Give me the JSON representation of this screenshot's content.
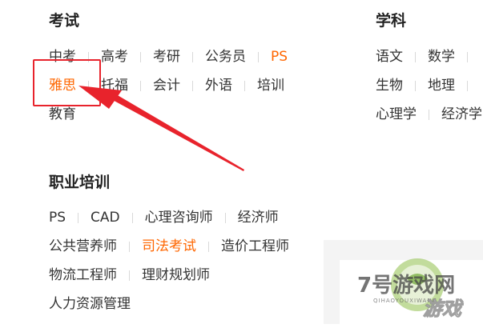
{
  "exam": {
    "title": "考试",
    "row1": [
      "中考",
      "高考",
      "考研",
      "公务员",
      "PS"
    ],
    "row2": [
      "雅思",
      "托福",
      "会计",
      "外语",
      "培训"
    ],
    "row3": [
      "教育"
    ]
  },
  "subject": {
    "title": "学科",
    "row1": [
      "语文",
      "数学"
    ],
    "row2": [
      "生物",
      "地理"
    ],
    "row3": [
      "心理学",
      "经济学"
    ]
  },
  "vocational": {
    "title": "职业培训",
    "row1": [
      "PS",
      "CAD",
      "心理咨询师",
      "经济师"
    ],
    "row2": [
      "公共营养师",
      "司法考试",
      "造价工程师"
    ],
    "row3": [
      "物流工程师",
      "理财规划师"
    ],
    "row4": [
      "人力资源管理"
    ]
  },
  "watermark": {
    "brand": "7号游戏网",
    "sub": "QIHAOYOUXIWANG",
    "game": "游戏"
  },
  "colors": {
    "accent_orange": "#ff6600",
    "annotation_red": "#e8232c"
  }
}
